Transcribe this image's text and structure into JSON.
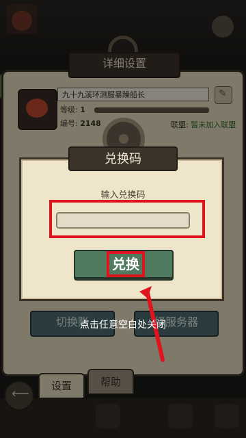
{
  "background": {
    "panel_title": "详细设置",
    "player_name": "九十九溪环测服暴躁船长",
    "level_label": "等级:",
    "level_value": "1",
    "id_label": "编号:",
    "id_value": "2148",
    "alliance_label": "联盟:",
    "alliance_value": "暂未加入联盟",
    "switch_button": "切换账",
    "server_button": "择服务器",
    "tabs": [
      {
        "label": "设置"
      },
      {
        "label": "帮助"
      }
    ]
  },
  "dialog": {
    "title": "兑换码",
    "input_label": "输入兑换码",
    "input_value": "",
    "input_placeholder": "",
    "redeem_button": "兑换",
    "close_hint": "点击任意空白处关闭"
  },
  "colors": {
    "highlight_red": "#e0141f",
    "redeem_green": "#4f7a5f",
    "parchment": "#efe5cb"
  }
}
